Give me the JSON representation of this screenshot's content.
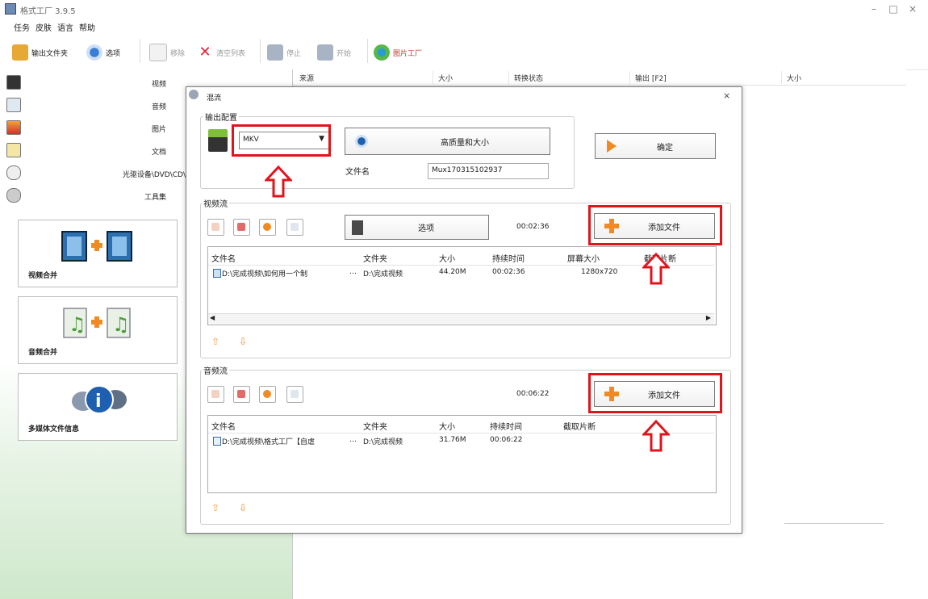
{
  "window": {
    "title": "格式工厂 3.9.5",
    "min_icon": "minimize-icon",
    "max_icon": "maximize-icon",
    "close_icon": "close-icon"
  },
  "menu": [
    "任务",
    "皮肤",
    "语言",
    "帮助"
  ],
  "toolbar": {
    "output_folder": "输出文件夹",
    "options": "选项",
    "remove": "移除",
    "clear_list": "清空列表",
    "stop": "停止",
    "start": "开始",
    "picture_factory": "图片工厂"
  },
  "sidebar": {
    "categories": [
      "视频",
      "音频",
      "图片",
      "文档",
      "光驱设备\\DVD\\CD\\",
      "工具集"
    ],
    "tools": [
      "视频合并",
      "音频合并",
      "多媒体文件信息"
    ]
  },
  "list_header": [
    "来源",
    "大小",
    "转换状态",
    "输出 [F2]",
    "大小"
  ],
  "dialog": {
    "title": "混流",
    "close": "×",
    "output_config": {
      "group_title": "输出配置",
      "format_value": "MKV",
      "quality_button": "高质量和大小",
      "filename_label": "文件名",
      "filename_value": "Mux170315102937",
      "ok_button": "确定"
    },
    "video": {
      "group_title": "视频流",
      "options_button": "选项",
      "duration": "00:02:36",
      "add_file": "添加文件",
      "columns": [
        "文件名",
        "文件夹",
        "大小",
        "持续时间",
        "屏幕大小",
        "截取片断"
      ],
      "rows": [
        {
          "name": "D:\\完成视频\\如何用一个制",
          "folder": "D:\\完成视频",
          "size": "44.20M",
          "duration": "00:02:36",
          "screen": "1280x720",
          "clip": ""
        }
      ]
    },
    "audio": {
      "group_title": "音频流",
      "duration": "00:06:22",
      "add_file": "添加文件",
      "columns": [
        "文件名",
        "文件夹",
        "大小",
        "持续时间",
        "截取片断"
      ],
      "rows": [
        {
          "name": "D:\\完成视频\\格式工厂【自虐",
          "folder": "D:\\完成视频",
          "size": "31.76M",
          "duration": "00:06:22",
          "clip": ""
        }
      ]
    }
  },
  "colors": {
    "highlight_red": "#e0141c",
    "plus_orange": "#f08a24",
    "sidebar_green": "#cfe8cc"
  }
}
